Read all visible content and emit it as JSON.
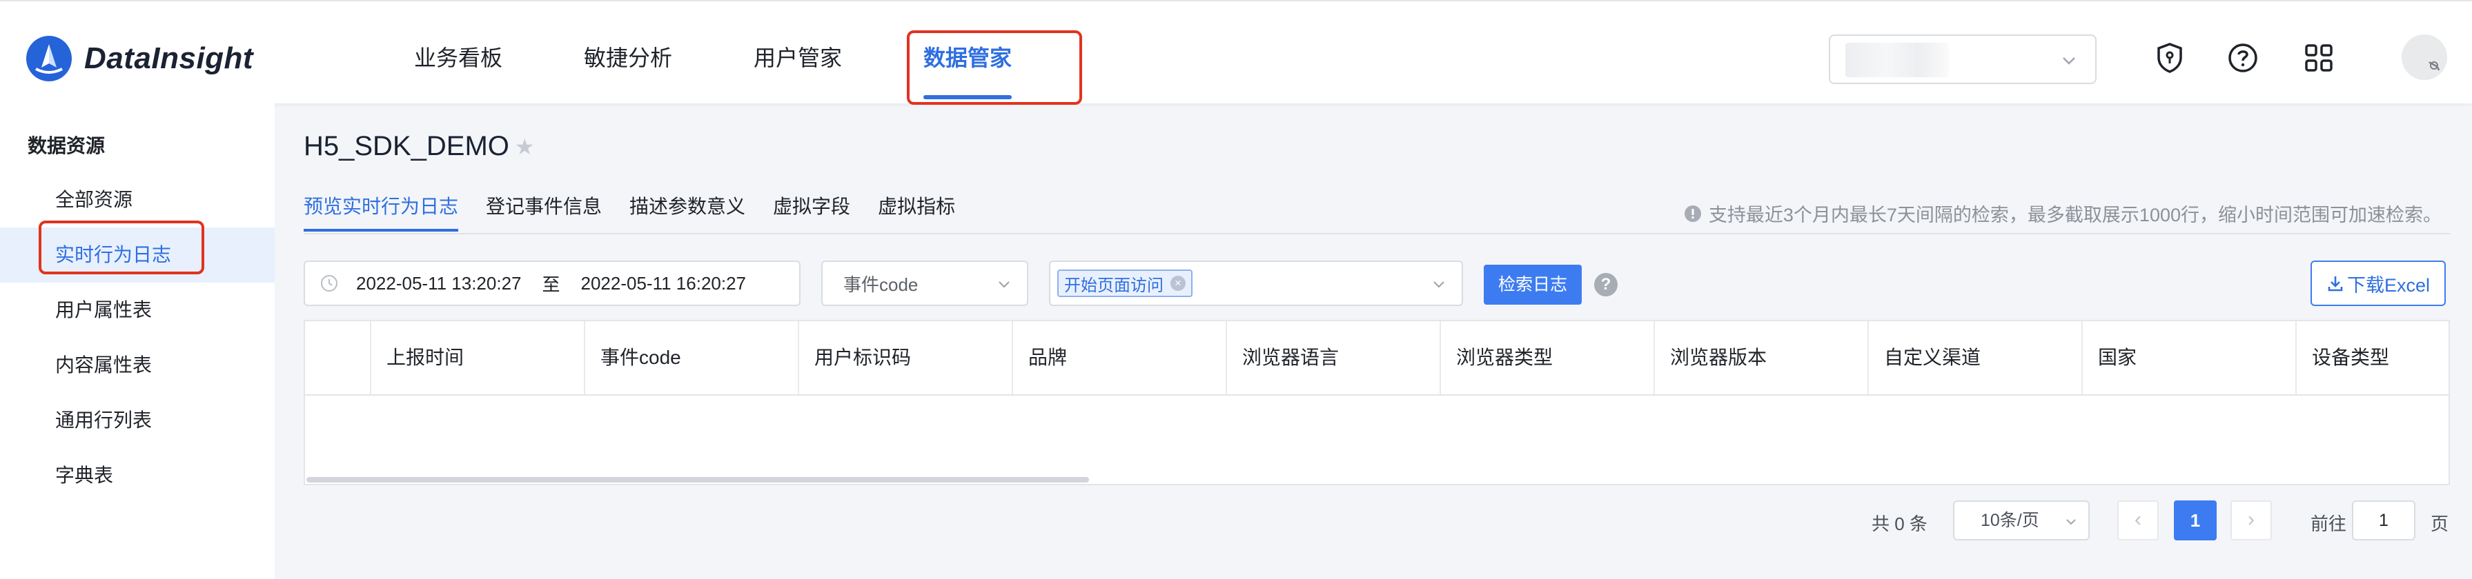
{
  "app": {
    "name": "DataInsight"
  },
  "nav": {
    "items": [
      {
        "label": "业务看板",
        "active": false
      },
      {
        "label": "敏捷分析",
        "active": false
      },
      {
        "label": "用户管家",
        "active": false
      },
      {
        "label": "数据管家",
        "active": true
      }
    ]
  },
  "header_icons": [
    "shield-icon",
    "help-icon",
    "apps-grid-icon"
  ],
  "sidebar": {
    "title": "数据资源",
    "items": [
      {
        "label": "全部资源",
        "active": false
      },
      {
        "label": "实时行为日志",
        "active": true
      },
      {
        "label": "用户属性表",
        "active": false
      },
      {
        "label": "内容属性表",
        "active": false
      },
      {
        "label": "通用行列表",
        "active": false
      },
      {
        "label": "字典表",
        "active": false
      }
    ]
  },
  "page": {
    "title": "H5_SDK_DEMO",
    "tabs": [
      {
        "label": "预览实时行为日志",
        "active": true
      },
      {
        "label": "登记事件信息",
        "active": false
      },
      {
        "label": "描述参数意义",
        "active": false
      },
      {
        "label": "虚拟字段",
        "active": false
      },
      {
        "label": "虚拟指标",
        "active": false
      }
    ],
    "hint": "支持最近3个月内最长7天间隔的检索，最多截取展示1000行，缩小时间范围可加速检索。"
  },
  "filters": {
    "start_time": "2022-05-11 13:20:27",
    "range_separator": "至",
    "end_time": "2022-05-11 16:20:27",
    "event_code_placeholder": "事件code",
    "selected_event_tag": "开始页面访问",
    "search_button": "检索日志",
    "help_mark": "?",
    "download_button": "下载Excel"
  },
  "table": {
    "columns": [
      "上报时间",
      "事件code",
      "用户标识码",
      "品牌",
      "浏览器语言",
      "浏览器类型",
      "浏览器版本",
      "自定义渠道",
      "国家",
      "设备类型"
    ],
    "rows": []
  },
  "pagination": {
    "total_text": "共 0 条",
    "page_size": "10条/页",
    "current_page": "1",
    "goto_prefix": "前往",
    "goto_value": "1",
    "goto_suffix": "页"
  },
  "colors": {
    "accent": "#2f6fe0",
    "annotation_red": "#e0331f",
    "primary_button": "#3d7cf0"
  }
}
